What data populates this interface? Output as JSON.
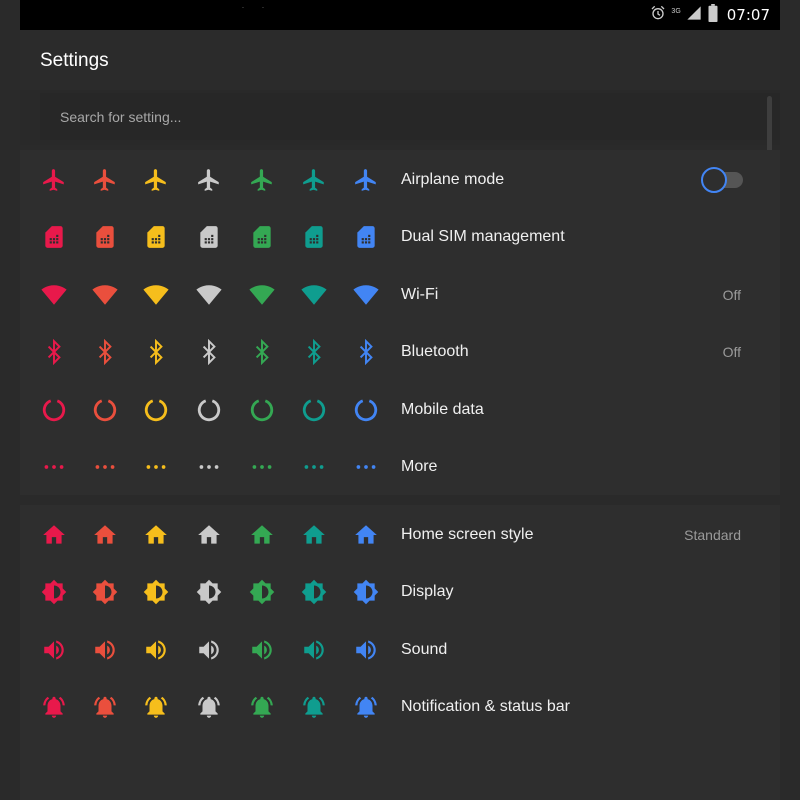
{
  "status_bar": {
    "time": "07:07",
    "network": "3G"
  },
  "app_bar": {
    "title": "Settings"
  },
  "search": {
    "placeholder": "Search for setting..."
  },
  "palette": [
    "#e8194b",
    "#ea4f3d",
    "#f6be1c",
    "#c9c9c9",
    "#34a853",
    "#0f9d8f",
    "#4285f4"
  ],
  "section1": [
    {
      "label": "Airplane mode",
      "icon": "airplane-icon",
      "control": "toggle",
      "toggle_on": false
    },
    {
      "label": "Dual SIM management",
      "icon": "sim-card-icon"
    },
    {
      "label": "Wi-Fi",
      "icon": "wifi-icon",
      "value": "Off"
    },
    {
      "label": "Bluetooth",
      "icon": "bluetooth-icon",
      "value": "Off"
    },
    {
      "label": "Mobile data",
      "icon": "mobile-data-icon"
    },
    {
      "label": "More",
      "icon": "more-dots-icon"
    }
  ],
  "section2": [
    {
      "label": "Home screen style",
      "icon": "home-icon",
      "value": "Standard"
    },
    {
      "label": "Display",
      "icon": "brightness-icon"
    },
    {
      "label": "Sound",
      "icon": "volume-icon"
    },
    {
      "label": "Notification & status bar",
      "icon": "bell-icon"
    }
  ]
}
